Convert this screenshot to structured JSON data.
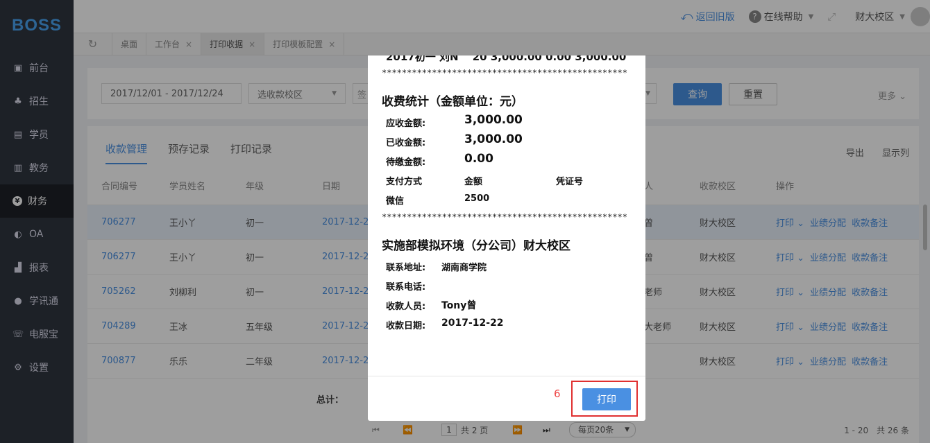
{
  "logo": "BOSS",
  "sidebar": {
    "items": [
      {
        "label": "前台",
        "icon": "calendar-icon"
      },
      {
        "label": "招生",
        "icon": "recruit-icon"
      },
      {
        "label": "学员",
        "icon": "student-icon"
      },
      {
        "label": "教务",
        "icon": "book-icon"
      },
      {
        "label": "财务",
        "icon": "yen-icon",
        "active": true
      },
      {
        "label": "OA",
        "icon": "chat-icon"
      },
      {
        "label": "报表",
        "icon": "chart-icon"
      },
      {
        "label": "学讯通",
        "icon": "location-icon"
      },
      {
        "label": "电服宝",
        "icon": "phone-icon"
      },
      {
        "label": "设置",
        "icon": "gear-icon"
      }
    ]
  },
  "topbar": {
    "back_old": "返回旧版",
    "help": "在线帮助",
    "campus": "财大校区"
  },
  "tabs": [
    {
      "label": "桌面"
    },
    {
      "label": "工作台"
    },
    {
      "label": "打印收据",
      "active": true
    },
    {
      "label": "打印模板配置"
    }
  ],
  "filter": {
    "date_range": "2017/12/01 - 2017/12/24",
    "campus_placeholder": "选收款校区",
    "sign_placeholder": "签",
    "query": "查询",
    "reset": "重置",
    "more": "更多"
  },
  "subtabs": [
    "收款管理",
    "预存记录",
    "打印记录"
  ],
  "table_actions": {
    "export": "导出",
    "columns": "显示列"
  },
  "columns": [
    "合同编号",
    "学员姓名",
    "年级",
    "日期",
    "人",
    "收款校区",
    "操作"
  ],
  "rows": [
    {
      "contract": "706277",
      "name": "王小丫",
      "grade": "初一",
      "date": "2017-12-2",
      "person": "曾",
      "campus": "财大校区"
    },
    {
      "contract": "706277",
      "name": "王小丫",
      "grade": "初一",
      "date": "2017-12-2",
      "person": "曾",
      "campus": "财大校区"
    },
    {
      "contract": "705262",
      "name": "刘柳利",
      "grade": "初一",
      "date": "2017-12-2",
      "person": "老师",
      "campus": "财大校区"
    },
    {
      "contract": "704289",
      "name": "王冰",
      "grade": "五年级",
      "date": "2017-12-2",
      "person": "大老师",
      "campus": "财大校区"
    },
    {
      "contract": "700877",
      "name": "乐乐",
      "grade": "二年级",
      "date": "2017-12-2",
      "person": "",
      "campus": "财大校区"
    }
  ],
  "row_ops": {
    "print": "打印",
    "assign": "业绩分配",
    "note": "收款备注"
  },
  "total_label": "总计：",
  "pager": {
    "page": "1",
    "total_pages": "共 2 页",
    "per_page": "每页20条",
    "summary": "1 - 20　共 26 条"
  },
  "receipt": {
    "top_line": "2017初一 刘N　 20 3,000.00 0.00 3,000.00",
    "stars": "*************************************************",
    "stats_title": "收费统计（金额单位：元）",
    "due_label": "应收金额:",
    "due_value": "3,000.00",
    "paid_label": "已收金额:",
    "paid_value": "3,000.00",
    "owed_label": "待缴金额:",
    "owed_value": "0.00",
    "pay_method_label": "支付方式",
    "amount_label": "金额",
    "voucher_label": "凭证号",
    "pay_method": "微信",
    "pay_amount": "2500",
    "org_title": "实施部模拟环境（分公司）财大校区",
    "address_label": "联系地址:",
    "address": "湖南商学院",
    "phone_label": "联系电话:",
    "phone": "",
    "cashier_label": "收款人员:",
    "cashier": "Tony曾",
    "date_label": "收款日期:",
    "date": "2017-12-22"
  },
  "modal": {
    "step": "6",
    "print_button": "打印"
  }
}
